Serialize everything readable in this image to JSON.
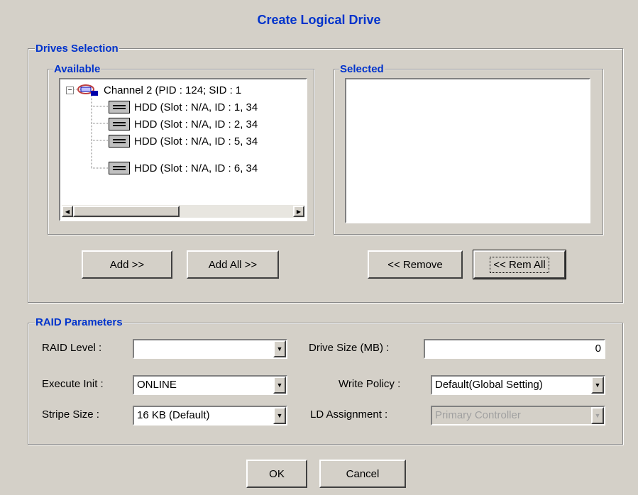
{
  "dialog": {
    "title": "Create Logical Drive"
  },
  "drives_selection": {
    "label": "Drives Selection",
    "available": {
      "label": "Available",
      "channel": "Channel 2 (PID : 124; SID : 1",
      "drives": [
        "HDD  (Slot : N/A, ID : 1, 34",
        "HDD  (Slot : N/A, ID : 2, 34",
        "HDD  (Slot : N/A, ID : 5, 34",
        "HDD  (Slot : N/A, ID : 6, 34"
      ]
    },
    "selected": {
      "label": "Selected"
    },
    "buttons": {
      "add": "Add >>",
      "add_all": "Add All >>",
      "remove": "<< Remove",
      "rem_all": "<< Rem All"
    }
  },
  "raid_parameters": {
    "label": "RAID Parameters",
    "raid_level": {
      "label": "RAID Level :",
      "value": ""
    },
    "execute_init": {
      "label": "Execute Init :",
      "value": "ONLINE"
    },
    "stripe_size": {
      "label": "Stripe Size :",
      "value": "16 KB (Default)"
    },
    "drive_size": {
      "label": "Drive Size (MB) :",
      "value": "0"
    },
    "write_policy": {
      "label": "Write Policy :",
      "value": "Default(Global Setting)"
    },
    "ld_assignment": {
      "label": "LD Assignment :",
      "value": "Primary Controller"
    }
  },
  "footer": {
    "ok": "OK",
    "cancel": "Cancel"
  }
}
